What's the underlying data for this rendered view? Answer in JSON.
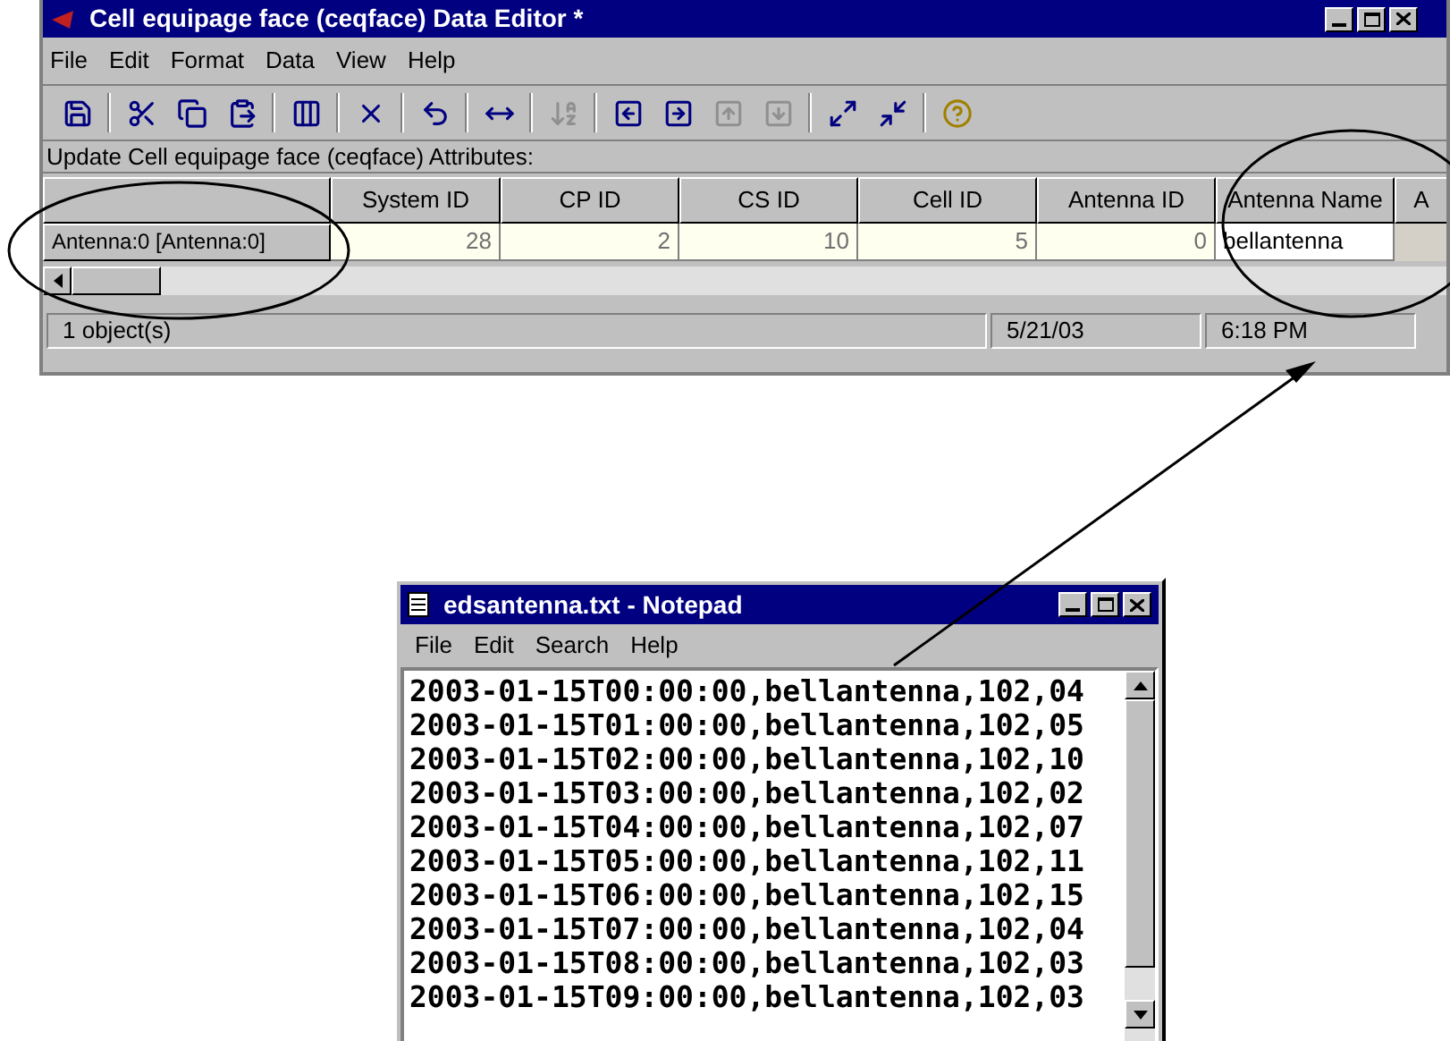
{
  "editor": {
    "title": "Cell equipage face (ceqface) Data Editor *",
    "menu": [
      "File",
      "Edit",
      "Format",
      "Data",
      "View",
      "Help"
    ],
    "toolbar": [
      {
        "kind": "save",
        "disabled": false
      },
      {
        "kind": "sep"
      },
      {
        "kind": "cut",
        "disabled": false
      },
      {
        "kind": "copy",
        "disabled": false
      },
      {
        "kind": "paste",
        "disabled": false
      },
      {
        "kind": "sep"
      },
      {
        "kind": "addcol",
        "disabled": false
      },
      {
        "kind": "sep"
      },
      {
        "kind": "delete",
        "disabled": false
      },
      {
        "kind": "sep"
      },
      {
        "kind": "undo",
        "disabled": false
      },
      {
        "kind": "sep"
      },
      {
        "kind": "fit",
        "disabled": false
      },
      {
        "kind": "sep"
      },
      {
        "kind": "sort",
        "disabled": true
      },
      {
        "kind": "sep"
      },
      {
        "kind": "left",
        "disabled": false
      },
      {
        "kind": "right",
        "disabled": false
      },
      {
        "kind": "up",
        "disabled": true
      },
      {
        "kind": "down",
        "disabled": true
      },
      {
        "kind": "sep"
      },
      {
        "kind": "expand",
        "disabled": false
      },
      {
        "kind": "shrink",
        "disabled": false
      },
      {
        "kind": "sep"
      },
      {
        "kind": "help",
        "disabled": false
      }
    ],
    "caption": "Update Cell equipage face (ceqface) Attributes:",
    "table": {
      "columns": [
        "System ID",
        "CP ID",
        "CS ID",
        "Cell ID",
        "Antenna ID",
        "Antenna Name",
        "A"
      ],
      "rows": [
        {
          "header": "Antenna:0 [Antenna:0]",
          "cells": [
            "28",
            "2",
            "10",
            "5",
            "0",
            "bellantenna"
          ]
        }
      ]
    },
    "status_bar": [
      "1 object(s)",
      "5/21/03",
      "6:18 PM"
    ]
  },
  "notepad": {
    "title": "edsantenna.txt - Notepad",
    "menu": [
      "File",
      "Edit",
      "Search",
      "Help"
    ],
    "lines": [
      "2003-01-15T00:00:00,bellantenna,102,04",
      "2003-01-15T01:00:00,bellantenna,102,05",
      "2003-01-15T02:00:00,bellantenna,102,10",
      "2003-01-15T03:00:00,bellantenna,102,02",
      "2003-01-15T04:00:00,bellantenna,102,07",
      "2003-01-15T05:00:00,bellantenna,102,11",
      "2003-01-15T06:00:00,bellantenna,102,15",
      "2003-01-15T07:00:00,bellantenna,102,04",
      "2003-01-15T08:00:00,bellantenna,102,03",
      "2003-01-15T09:00:00,bellantenna,102,03"
    ]
  }
}
